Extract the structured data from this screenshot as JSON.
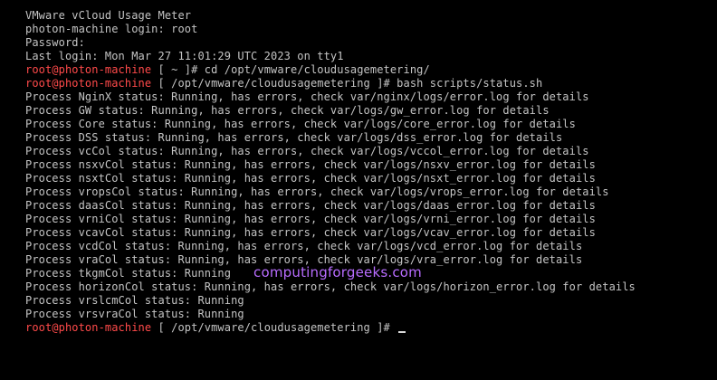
{
  "terminal": {
    "banner": "VMware vCloud Usage Meter",
    "login": "photon-machine login: root",
    "password": "Password:",
    "last_login": "Last login: Mon Mar 27 11:01:29 UTC 2023 on tty1",
    "cmd1": {
      "user": "root@photon-machine",
      "rest": " [ ~ ]# cd /opt/vmware/cloudusagemetering/"
    },
    "cmd2": {
      "user": "root@photon-machine",
      "rest": " [ /opt/vmware/cloudusagemetering ]# bash scripts/status.sh"
    },
    "output": [
      "Process NginX status: Running, has errors, check var/nginx/logs/error.log for details",
      "Process GW status: Running, has errors, check var/logs/gw_error.log for details",
      "Process Core status: Running, has errors, check var/logs/core_error.log for details",
      "Process DSS status: Running, has errors, check var/logs/dss_error.log for details",
      "Process vcCol status: Running, has errors, check var/logs/vccol_error.log for details",
      "Process nsxvCol status: Running, has errors, check var/logs/nsxv_error.log for details",
      "Process nsxtCol status: Running, has errors, check var/logs/nsxt_error.log for details",
      "Process vropsCol status: Running, has errors, check var/logs/vrops_error.log for details",
      "Process daasCol status: Running, has errors, check var/logs/daas_error.log for details",
      "Process vrniCol status: Running, has errors, check var/logs/vrni_error.log for details",
      "Process vcavCol status: Running, has errors, check var/logs/vcav_error.log for details",
      "Process vcdCol status: Running, has errors, check var/logs/vcd_error.log for details",
      "Process vraCol status: Running, has errors, check var/logs/vra_error.log for details",
      "Process tkgmCol status: Running",
      "Process horizonCol status: Running, has errors, check var/logs/horizon_error.log for details",
      "Process vrslcmCol status: Running",
      "Process vrsvraCol status: Running"
    ],
    "cmd3": {
      "user": "root@photon-machine",
      "rest": " [ /opt/vmware/cloudusagemetering ]# "
    }
  },
  "watermark": "computingforgeeks.com",
  "colors": {
    "background": "#000000",
    "text": "#c4c4c4",
    "prompt_user": "#ff4a4a",
    "watermark": "#b86cff"
  }
}
